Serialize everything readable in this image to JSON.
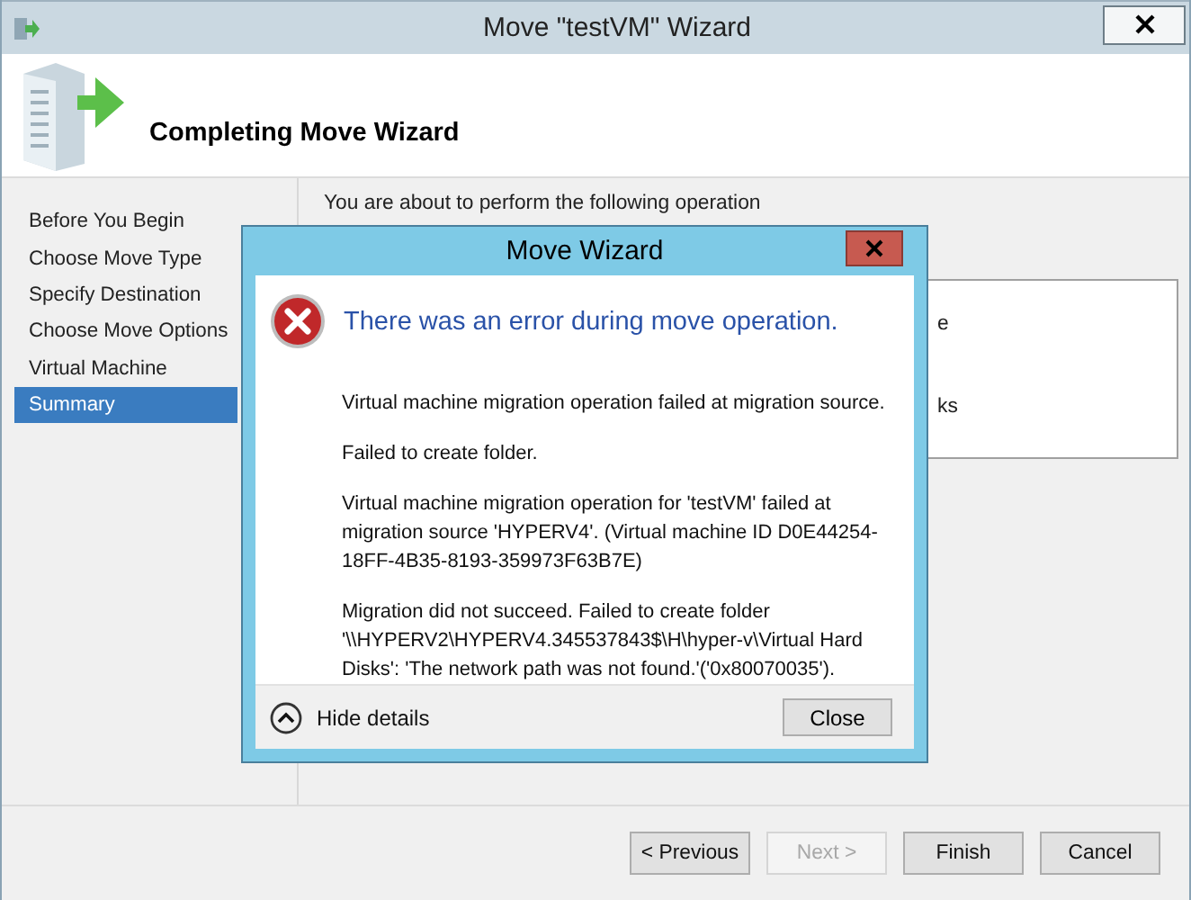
{
  "window": {
    "title": "Move \"testVM\" Wizard"
  },
  "header": {
    "title": "Completing Move Wizard"
  },
  "steps": [
    {
      "label": "Before You Begin",
      "selected": false
    },
    {
      "label": "Choose Move Type",
      "selected": false
    },
    {
      "label": "Specify Destination",
      "selected": false
    },
    {
      "label": "Choose Move Options",
      "selected": false
    },
    {
      "label": "Virtual Machine",
      "selected": false
    },
    {
      "label": "Summary",
      "selected": true
    }
  ],
  "content": {
    "intro": "You are about to perform the following operation",
    "summary_fragments": [
      "e",
      "ks"
    ]
  },
  "buttons": [
    {
      "label": "< Previous",
      "disabled": false
    },
    {
      "label": "Next >",
      "disabled": true
    },
    {
      "label": "Finish",
      "disabled": false
    },
    {
      "label": "Cancel",
      "disabled": false
    }
  ],
  "dialog": {
    "title": "Move Wizard",
    "heading": "There was an error during move operation.",
    "messages": [
      "Virtual machine migration operation failed at migration source.",
      "Failed to create folder.",
      "Virtual machine migration operation for 'testVM' failed at migration source 'HYPERV4'. (Virtual machine ID D0E44254-18FF-4B35-8193-359973F63B7E)",
      "Migration did not succeed. Failed to create folder '\\\\HYPERV2\\HYPERV4.345537843$\\H\\hyper-v\\Virtual Hard Disks': 'The network path was not found.'('0x80070035')."
    ],
    "details_toggle": {
      "label": "Hide details",
      "expanded": true
    },
    "close_button": "Close"
  }
}
